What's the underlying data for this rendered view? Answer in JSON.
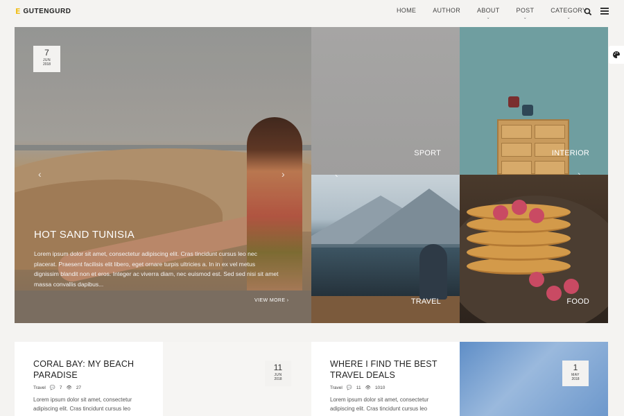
{
  "header": {
    "logo_mark": "E",
    "logo_text": "GUTENGURD",
    "nav": [
      {
        "label": "HOME",
        "has_caret": false
      },
      {
        "label": "AUTHOR",
        "has_caret": false
      },
      {
        "label": "ABOUT",
        "has_caret": true
      },
      {
        "label": "POST",
        "has_caret": true
      },
      {
        "label": "CATEGORY",
        "has_caret": true
      }
    ],
    "icons": {
      "search": "search-icon",
      "menu": "menu-icon"
    }
  },
  "hero": {
    "date": {
      "day": "7",
      "month": "JUN",
      "year": "2018"
    },
    "title": "HOT SAND TUNISIA",
    "excerpt": "Lorem ipsum dolor sit amet, consectetur adipiscing elit. Cras tincidunt cursus leo nec placerat. Praesent facilisis elit libero, eget ornare turpis ultricies a. In in ex vel metus dignissim blandit non et eros. Integer ac viverra diam, nec euismod est. Sed sed nisi sit amet massa convallis dapibus...",
    "view_more": "VIEW MORE",
    "tiles": [
      {
        "label": "SPORT"
      },
      {
        "label": "INTERIOR"
      },
      {
        "label": "TRAVEL"
      },
      {
        "label": "FOOD"
      }
    ]
  },
  "cards": [
    {
      "title": "CORAL BAY: MY BEACH PARADISE",
      "category": "Travel",
      "comments": "7",
      "views": "27",
      "excerpt": "Lorem ipsum dolor sit amet, consectetur adipiscing elit. Cras tincidunt cursus leo",
      "date": {
        "day": "11",
        "month": "JUN",
        "year": "2018"
      }
    },
    {
      "title": "WHERE I FIND THE BEST TRAVEL DEALS",
      "category": "Travel",
      "comments": "11",
      "views": "1010",
      "excerpt": "Lorem ipsum dolor sit amet, consectetur adipiscing elit. Cras tincidunt cursus leo",
      "date": {
        "day": "1",
        "month": "MAY",
        "year": "2018"
      }
    }
  ],
  "colors": {
    "accent": "#f0c020",
    "background": "#f4f3f1"
  }
}
